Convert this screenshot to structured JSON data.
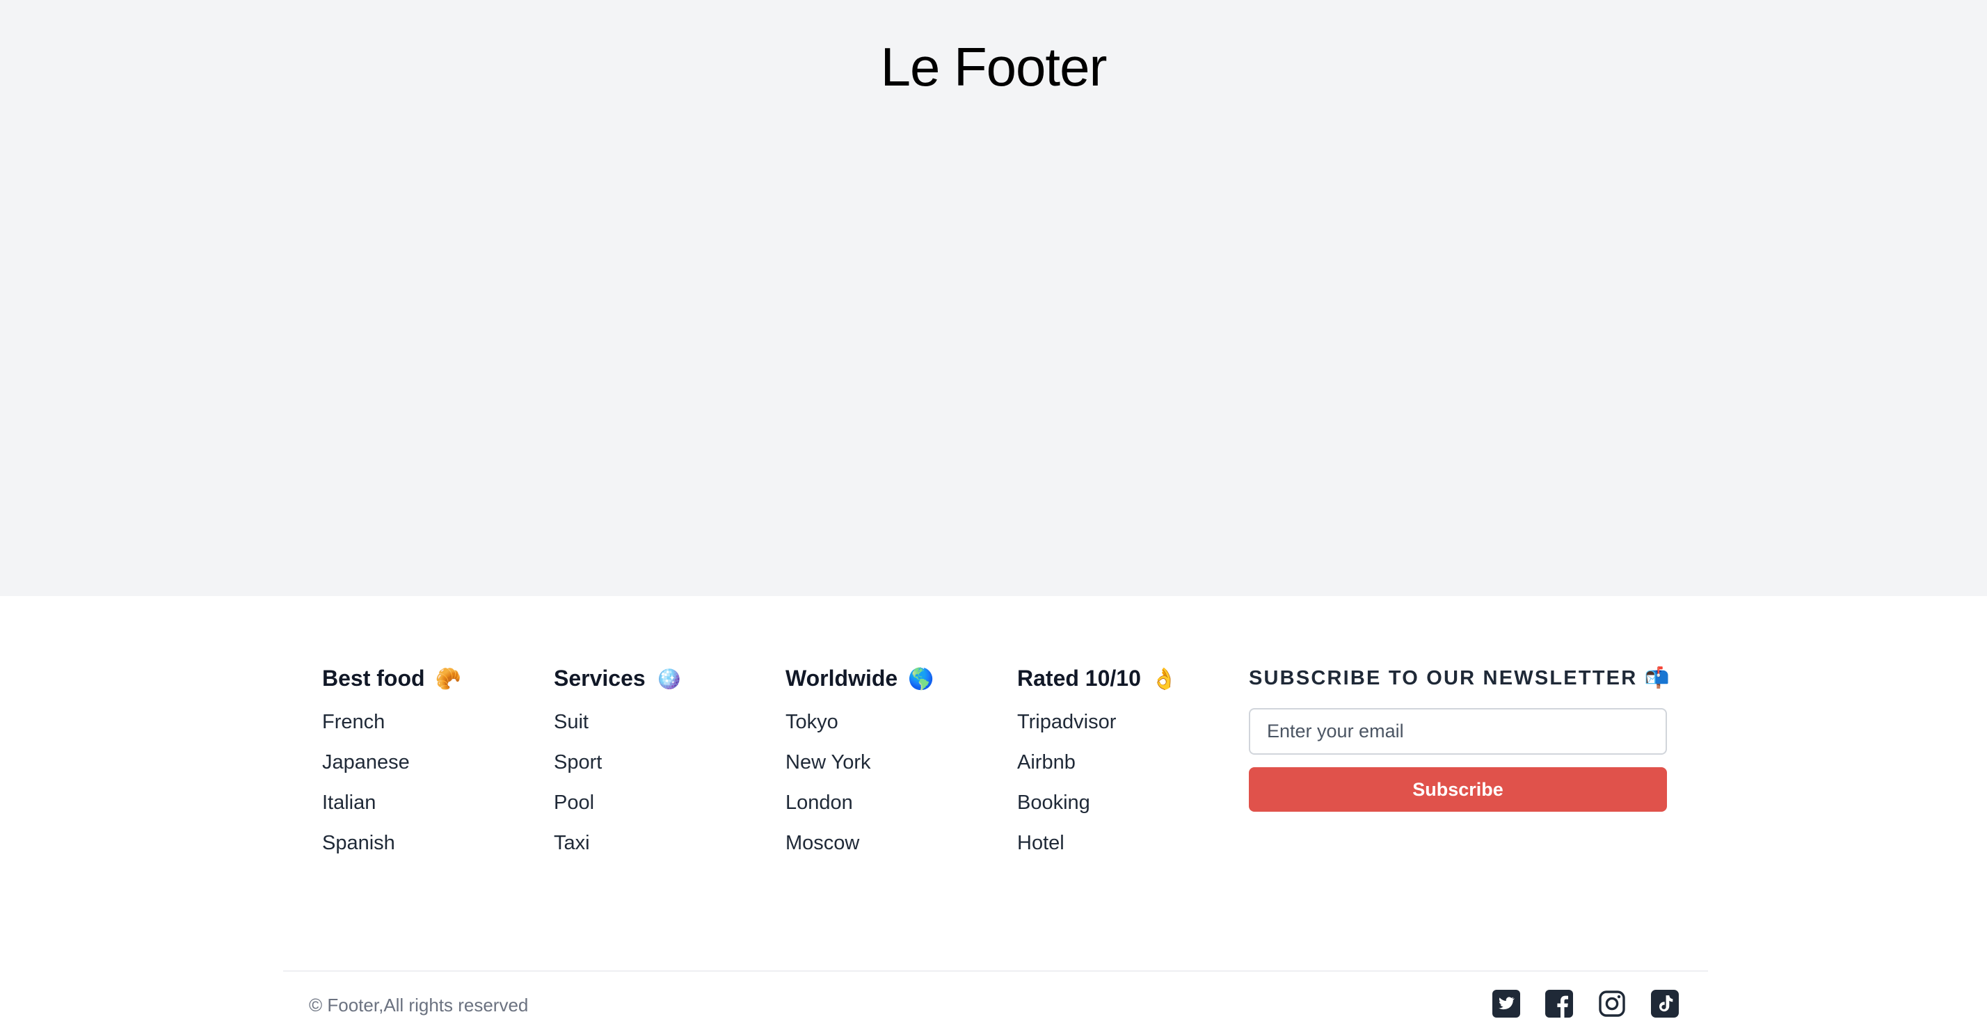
{
  "hero": {
    "title": "Le Footer"
  },
  "columns": [
    {
      "title": "Best food",
      "emoji": "🥐",
      "items": [
        "French",
        "Japanese",
        "Italian",
        "Spanish"
      ]
    },
    {
      "title": "Services",
      "emoji": "🪩",
      "items": [
        "Suit",
        "Sport",
        "Pool",
        "Taxi"
      ]
    },
    {
      "title": "Worldwide",
      "emoji": "🌎",
      "items": [
        "Tokyo",
        "New York",
        "London",
        "Moscow"
      ]
    },
    {
      "title": "Rated 10/10",
      "emoji": "👌",
      "items": [
        "Tripadvisor",
        "Airbnb",
        "Booking",
        "Hotel"
      ]
    }
  ],
  "newsletter": {
    "title": "SUBSCRIBE TO OUR NEWSLETTER 📬",
    "email_placeholder": "Enter your email",
    "email_value": "",
    "button_label": "Subscribe"
  },
  "bottom": {
    "copyright": "© Footer,All rights reserved",
    "socials": [
      "twitter-icon",
      "facebook-icon",
      "instagram-icon",
      "tiktok-icon"
    ]
  },
  "colors": {
    "hero_bg": "#f3f4f6",
    "accent": "#e0524b",
    "icon": "#1f2937"
  }
}
